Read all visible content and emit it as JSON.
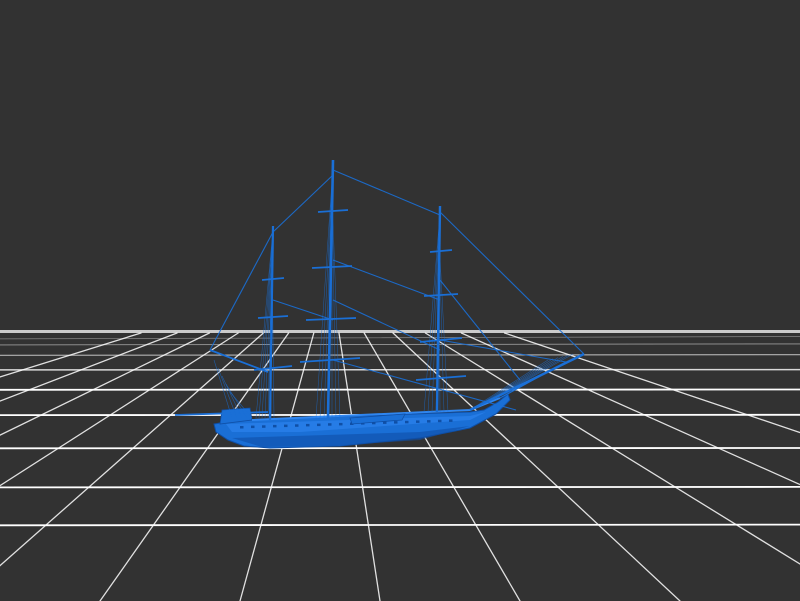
{
  "scene": {
    "background_color": "#323232",
    "grid": {
      "visible": true,
      "line_color": "#ffffff"
    },
    "model": {
      "kind": "three-masted sailing ship",
      "color": "#1a6fd6",
      "highlight_color": "#2f86f0",
      "shadow_color": "#0f4fa6",
      "masts": 3
    }
  }
}
